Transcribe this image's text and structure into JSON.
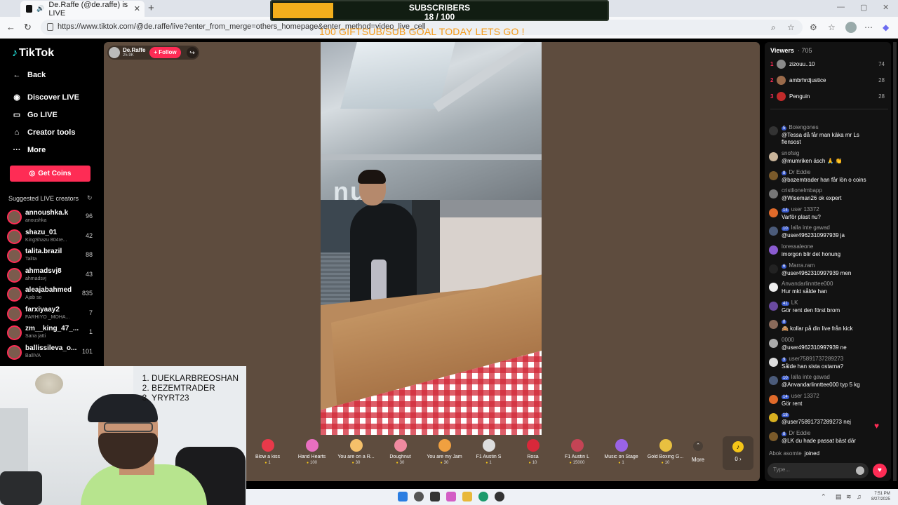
{
  "browser": {
    "tab_title": "De.Raffe (@de.raffe) is LIVE",
    "tab_close": "✕",
    "new_tab": "+",
    "url": "https://www.tiktok.com/@de.raffe/live?enter_from_merge=others_homepage&enter_method=video_live_cell"
  },
  "overlay": {
    "sub_title": "SUBSCRIBERS",
    "sub_count": "18 / 100",
    "sub_progress": 0.18,
    "goal_text": "100 GIFTSUB/SUB GOAL TODAY LETS GO !"
  },
  "sidebar": {
    "logo": "TikTok",
    "menu": [
      {
        "label": "Back",
        "icon": "back-arrow-icon"
      },
      {
        "label": "Discover LIVE",
        "icon": "discover-icon"
      },
      {
        "label": "Go LIVE",
        "icon": "camera-icon"
      },
      {
        "label": "Creator tools",
        "icon": "home-icon"
      },
      {
        "label": "More",
        "icon": "more-dots-icon"
      }
    ],
    "get_coins": "Get Coins",
    "suggested_title": "Suggested LIVE creators",
    "creators": [
      {
        "name": "annoushka.k",
        "sub": "anoushka",
        "count": "96"
      },
      {
        "name": "shazu_01",
        "sub": "KingShazu 804re...",
        "count": "42"
      },
      {
        "name": "talita.brazil",
        "sub": "Talita",
        "count": "88"
      },
      {
        "name": "ahmadsvj8",
        "sub": "ahmadsvj",
        "count": "43"
      },
      {
        "name": "aleajabahmed",
        "sub": "Ajab so",
        "count": "835"
      },
      {
        "name": "farxiyaay2",
        "sub": "FARHIYO _MOHA...",
        "count": "7"
      },
      {
        "name": "zm__king_47_...",
        "sub": "Sana jatti",
        "count": "1"
      },
      {
        "name": "ballissileva_o...",
        "sub": "BalliVA",
        "count": "101"
      }
    ]
  },
  "stream": {
    "host_name": "De.Raffe",
    "host_likes": "25.9K",
    "follow": "+ Follow",
    "store_sign": "nus"
  },
  "gifts": [
    {
      "name": "Blow a kiss",
      "price": "1",
      "color": "#e8394a"
    },
    {
      "name": "Hand Hearts",
      "price": "100",
      "color": "#e86fc0"
    },
    {
      "name": "You are on a R...",
      "price": "30",
      "color": "#f5c06a"
    },
    {
      "name": "Doughnut",
      "price": "30",
      "color": "#f08aa0"
    },
    {
      "name": "You are my Jam",
      "price": "30",
      "color": "#f0a040"
    },
    {
      "name": "F1 Austin S",
      "price": "1",
      "color": "#dddddd"
    },
    {
      "name": "Rosa",
      "price": "10",
      "color": "#d8283a"
    },
    {
      "name": "F1 Austin L",
      "price": "15000",
      "color": "#c44455"
    },
    {
      "name": "Music on Stage",
      "price": "1",
      "color": "#9a63e6"
    },
    {
      "name": "Gold Boxing G...",
      "price": "10",
      "color": "#e8c040"
    }
  ],
  "gift_more": "More",
  "coin_label": "0 ›",
  "webcam_list": [
    "DUEKLARBREOSHAN",
    "BEZEMTRADER",
    "YRYRT23"
  ],
  "viewers": {
    "title": "Viewers",
    "count": "· 705",
    "top": [
      {
        "rank": "1",
        "name": "zizouu..10",
        "score": "74"
      },
      {
        "rank": "2",
        "name": "ambrhrdjustice",
        "score": "28"
      },
      {
        "rank": "3",
        "name": "Penguin",
        "score": "28"
      }
    ]
  },
  "chat": [
    {
      "user": "Boiengones",
      "lv": "5",
      "msg": "@Tessa då får man käka mr Ls",
      "msg2": "flensost",
      "color": "#333333"
    },
    {
      "user": "snofsig",
      "lv": "",
      "msg": "@mumriken äsch 🙏 👏",
      "color": "#c9b49a"
    },
    {
      "user": "Dr Eddie",
      "lv": "8",
      "msg": "@bazemtrader han får lön o coins",
      "color": "#7a5a2a"
    },
    {
      "user": "cristlionelmbapp",
      "lv": "",
      "msg": "@Wiseman26 ok expert",
      "color": "#777777"
    },
    {
      "user": "user 13372",
      "lv": "14",
      "msg": "Varför plast nu?",
      "color": "#e06a2a"
    },
    {
      "user": "lalla inte gawad",
      "lv": "10",
      "msg": "@user4962310997939 ja",
      "color": "#4b5b7a"
    },
    {
      "user": "loressaleone",
      "lv": "",
      "msg": "imorgon blir det honung",
      "color": "#8a5bd0"
    },
    {
      "user": "Marra.ram",
      "lv": "6",
      "msg": "@user4962310997939 men",
      "color": "#222222"
    },
    {
      "user": "Anvandarlinnttee000",
      "lv": "",
      "msg": "Hur mkt sålde han",
      "color": "#eeeeee"
    },
    {
      "user": "LK",
      "lv": "41",
      "msg": "Gör rent den först brom",
      "color": "#6a4aa0"
    },
    {
      "user": "",
      "lv": "8",
      "msg": "🙈 kollar på din live från kick",
      "color": "#8a6a5a"
    },
    {
      "user": "0000",
      "lv": "",
      "msg": "@user4962310997939 ne",
      "color": "#aaaaaa"
    },
    {
      "user": "user75891737289273",
      "lv": "9",
      "msg": "Sålde han sista ostarna?",
      "color": "#dddddd"
    },
    {
      "user": "lalla inte gawad",
      "lv": "10",
      "msg": "@Anvandarlinnttee000 typ 5 kg",
      "color": "#4b5b7a"
    },
    {
      "user": "user 13372",
      "lv": "14",
      "msg": "Gör rent",
      "color": "#e06a2a"
    },
    {
      "user": "",
      "lv": "18",
      "msg": "@user75891737289273 nej",
      "color": "#d8b020"
    },
    {
      "user": "Dr Eddie",
      "lv": "8",
      "msg": "@LK du hade passat bäst där",
      "color": "#7a5a2a"
    }
  ],
  "joined": {
    "user": "Abok asomte",
    "text": "joined"
  },
  "chat_placeholder": "Type...",
  "clock": {
    "time": "7:51 PM",
    "date": "8/27/2025"
  }
}
